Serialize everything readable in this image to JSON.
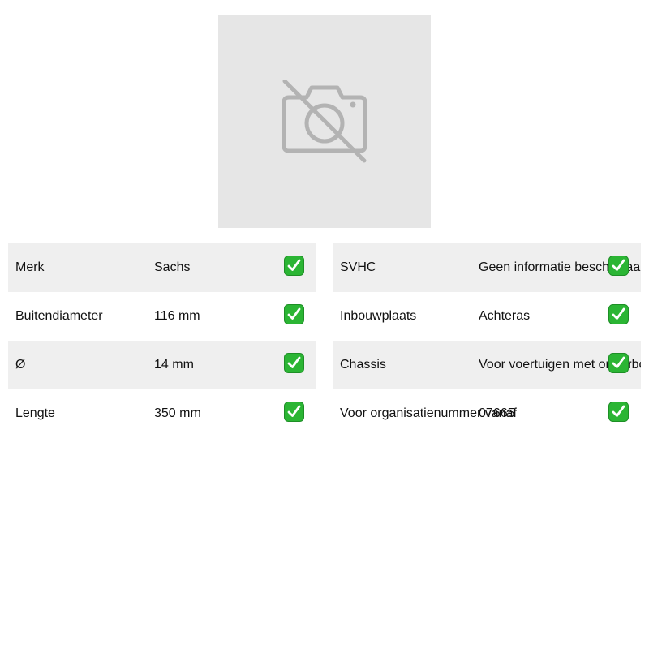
{
  "product_image": {
    "icon": "no-photo-icon"
  },
  "specs_left": [
    {
      "label": "Merk",
      "value": "Sachs"
    },
    {
      "label": "Buitendiameter",
      "value": "116 mm"
    },
    {
      "label": "Ø",
      "value": "14 mm"
    },
    {
      "label": "Lengte",
      "value": "350 mm"
    }
  ],
  "specs_right": [
    {
      "label": "SVHC",
      "value": "Geen informatie beschikbaar"
    },
    {
      "label": "Inbouwplaats",
      "value": "Achteras"
    },
    {
      "label": "Chassis",
      "value": "Voor voertuigen met onderbouw"
    },
    {
      "label": "Voor organisatienummer vanaf",
      "value": "07665"
    }
  ],
  "colors": {
    "check_green": "#2bb534",
    "row_alt": "#efefef",
    "placeholder_bg": "#e6e6e6",
    "placeholder_icon": "#b3b3b3"
  },
  "icons": {
    "check": "check-mark-button-icon"
  }
}
